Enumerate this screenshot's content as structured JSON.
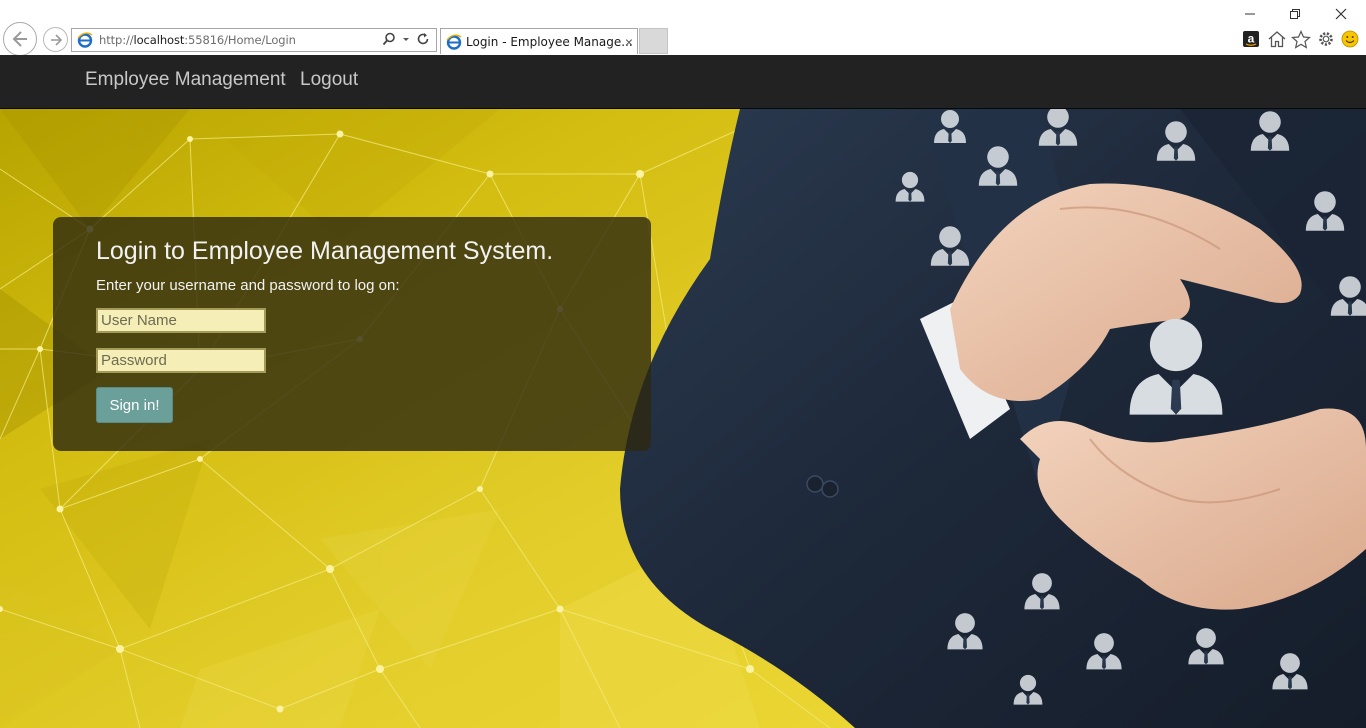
{
  "browser": {
    "url_prefix": "http://",
    "url_host": "localhost",
    "url_rest": ":55816/Home/Login",
    "tab_title": "Login - Employee Manage...",
    "tab_close": "×",
    "amazon_glyph": "a"
  },
  "navbar": {
    "brand": "Employee Management",
    "logout": "Logout"
  },
  "login": {
    "title": "Login to Employee Management System.",
    "subtitle": "Enter your username and password to log on:",
    "username_placeholder": "User Name",
    "password_placeholder": "Password",
    "submit_label": "Sign in!"
  },
  "colors": {
    "navbar_bg": "#222222",
    "hero_yellow": "#e4ce2c",
    "button_teal": "#6b9f9a",
    "input_bg": "#f6eeb7",
    "panel_bg": "rgba(44,40,16,0.80)",
    "suit_navy": "#1f2b3d"
  },
  "icons": [
    "back-arrow-icon",
    "forward-arrow-icon",
    "ie-logo-icon",
    "search-icon",
    "dropdown-icon",
    "refresh-icon",
    "close-icon",
    "amazon-icon",
    "home-icon",
    "star-icon",
    "gear-icon",
    "smiley-icon",
    "minimize-icon",
    "restore-icon"
  ]
}
